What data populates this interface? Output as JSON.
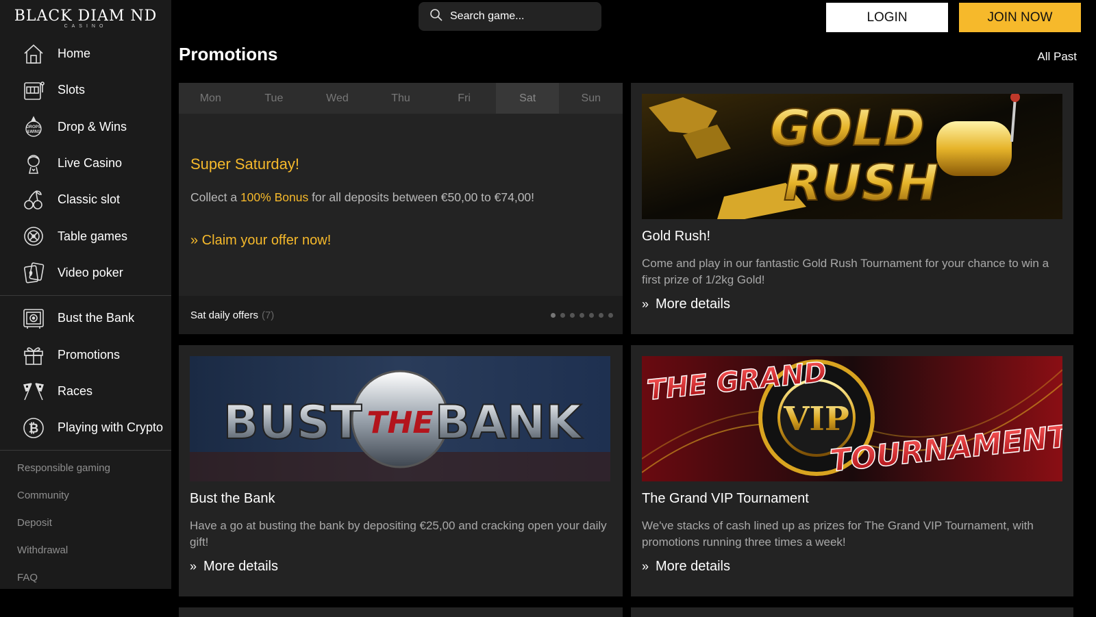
{
  "logo": {
    "main": "BLACK DIAM ND",
    "sub": "CASINO"
  },
  "sidebar": {
    "items": [
      {
        "label": "Home",
        "icon": "home-icon"
      },
      {
        "label": "Slots",
        "icon": "slots-icon"
      },
      {
        "label": "Drop & Wins",
        "icon": "drops-wins-icon"
      },
      {
        "label": "Live Casino",
        "icon": "live-dealer-icon"
      },
      {
        "label": "Classic slot",
        "icon": "cherries-icon"
      },
      {
        "label": "Table games",
        "icon": "roulette-icon"
      },
      {
        "label": "Video poker",
        "icon": "cards-icon"
      }
    ],
    "items2": [
      {
        "label": "Bust the Bank",
        "icon": "safe-icon"
      },
      {
        "label": "Promotions",
        "icon": "gift-icon"
      },
      {
        "label": "Races",
        "icon": "checkered-flags-icon"
      },
      {
        "label": "Playing with Crypto",
        "icon": "bitcoin-icon"
      }
    ],
    "links": [
      "Responsible gaming",
      "Community",
      "Deposit",
      "Withdrawal",
      "FAQ"
    ]
  },
  "header": {
    "search_placeholder": "Search game...",
    "login_label": "LOGIN",
    "join_label": "JOIN NOW"
  },
  "page": {
    "title": "Promotions",
    "all_past": "All Past"
  },
  "daily": {
    "days": [
      "Mon",
      "Tue",
      "Wed",
      "Thu",
      "Fri",
      "Sat",
      "Sun"
    ],
    "active_day": "Sat",
    "offer_title": "Super Saturday!",
    "offer_text_pre": "Collect a ",
    "offer_text_highlight": "100% Bonus",
    "offer_text_post": " for all deposits between €50,00 to €74,00!",
    "cta": "» Claim your offer now!",
    "footer_label": "Sat daily offers",
    "footer_count": "(7)",
    "dots_total": 7,
    "dots_active": 0
  },
  "promos": [
    {
      "banner_text": "GOLD RUSH",
      "title": "Gold Rush!",
      "text": "Come and play in our fantastic Gold Rush Tournament for your chance to win a first prize of 1/2kg Gold!",
      "more": "More details"
    },
    {
      "banner_text": "BUST THE BANK",
      "title": "Bust the Bank",
      "text": "Have a go at busting the bank by depositing €25,00 and cracking open your daily gift!",
      "more": "More details"
    },
    {
      "banner_text": "THE GRAND VIP TOURNAMENT",
      "title": "The Grand VIP Tournament",
      "text": "We've stacks of cash lined up as prizes for The Grand VIP Tournament, with promotions running three times a week!",
      "more": "More details"
    }
  ],
  "colors": {
    "accent": "#f6b92b",
    "sidebar_bg": "#1b1b1b",
    "card_bg": "#232323"
  }
}
